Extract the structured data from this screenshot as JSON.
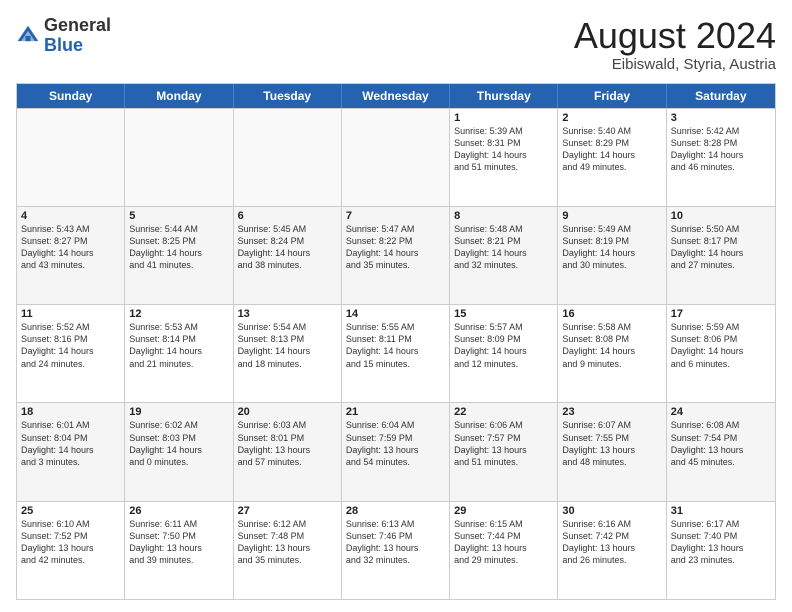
{
  "logo": {
    "general": "General",
    "blue": "Blue"
  },
  "title": {
    "month_year": "August 2024",
    "location": "Eibiswald, Styria, Austria"
  },
  "header_days": [
    "Sunday",
    "Monday",
    "Tuesday",
    "Wednesday",
    "Thursday",
    "Friday",
    "Saturday"
  ],
  "weeks": [
    [
      {
        "day": "",
        "info": "",
        "empty": true
      },
      {
        "day": "",
        "info": "",
        "empty": true
      },
      {
        "day": "",
        "info": "",
        "empty": true
      },
      {
        "day": "",
        "info": "",
        "empty": true
      },
      {
        "day": "1",
        "info": "Sunrise: 5:39 AM\nSunset: 8:31 PM\nDaylight: 14 hours\nand 51 minutes.",
        "empty": false
      },
      {
        "day": "2",
        "info": "Sunrise: 5:40 AM\nSunset: 8:29 PM\nDaylight: 14 hours\nand 49 minutes.",
        "empty": false
      },
      {
        "day": "3",
        "info": "Sunrise: 5:42 AM\nSunset: 8:28 PM\nDaylight: 14 hours\nand 46 minutes.",
        "empty": false
      }
    ],
    [
      {
        "day": "4",
        "info": "Sunrise: 5:43 AM\nSunset: 8:27 PM\nDaylight: 14 hours\nand 43 minutes.",
        "empty": false
      },
      {
        "day": "5",
        "info": "Sunrise: 5:44 AM\nSunset: 8:25 PM\nDaylight: 14 hours\nand 41 minutes.",
        "empty": false
      },
      {
        "day": "6",
        "info": "Sunrise: 5:45 AM\nSunset: 8:24 PM\nDaylight: 14 hours\nand 38 minutes.",
        "empty": false
      },
      {
        "day": "7",
        "info": "Sunrise: 5:47 AM\nSunset: 8:22 PM\nDaylight: 14 hours\nand 35 minutes.",
        "empty": false
      },
      {
        "day": "8",
        "info": "Sunrise: 5:48 AM\nSunset: 8:21 PM\nDaylight: 14 hours\nand 32 minutes.",
        "empty": false
      },
      {
        "day": "9",
        "info": "Sunrise: 5:49 AM\nSunset: 8:19 PM\nDaylight: 14 hours\nand 30 minutes.",
        "empty": false
      },
      {
        "day": "10",
        "info": "Sunrise: 5:50 AM\nSunset: 8:17 PM\nDaylight: 14 hours\nand 27 minutes.",
        "empty": false
      }
    ],
    [
      {
        "day": "11",
        "info": "Sunrise: 5:52 AM\nSunset: 8:16 PM\nDaylight: 14 hours\nand 24 minutes.",
        "empty": false
      },
      {
        "day": "12",
        "info": "Sunrise: 5:53 AM\nSunset: 8:14 PM\nDaylight: 14 hours\nand 21 minutes.",
        "empty": false
      },
      {
        "day": "13",
        "info": "Sunrise: 5:54 AM\nSunset: 8:13 PM\nDaylight: 14 hours\nand 18 minutes.",
        "empty": false
      },
      {
        "day": "14",
        "info": "Sunrise: 5:55 AM\nSunset: 8:11 PM\nDaylight: 14 hours\nand 15 minutes.",
        "empty": false
      },
      {
        "day": "15",
        "info": "Sunrise: 5:57 AM\nSunset: 8:09 PM\nDaylight: 14 hours\nand 12 minutes.",
        "empty": false
      },
      {
        "day": "16",
        "info": "Sunrise: 5:58 AM\nSunset: 8:08 PM\nDaylight: 14 hours\nand 9 minutes.",
        "empty": false
      },
      {
        "day": "17",
        "info": "Sunrise: 5:59 AM\nSunset: 8:06 PM\nDaylight: 14 hours\nand 6 minutes.",
        "empty": false
      }
    ],
    [
      {
        "day": "18",
        "info": "Sunrise: 6:01 AM\nSunset: 8:04 PM\nDaylight: 14 hours\nand 3 minutes.",
        "empty": false
      },
      {
        "day": "19",
        "info": "Sunrise: 6:02 AM\nSunset: 8:03 PM\nDaylight: 14 hours\nand 0 minutes.",
        "empty": false
      },
      {
        "day": "20",
        "info": "Sunrise: 6:03 AM\nSunset: 8:01 PM\nDaylight: 13 hours\nand 57 minutes.",
        "empty": false
      },
      {
        "day": "21",
        "info": "Sunrise: 6:04 AM\nSunset: 7:59 PM\nDaylight: 13 hours\nand 54 minutes.",
        "empty": false
      },
      {
        "day": "22",
        "info": "Sunrise: 6:06 AM\nSunset: 7:57 PM\nDaylight: 13 hours\nand 51 minutes.",
        "empty": false
      },
      {
        "day": "23",
        "info": "Sunrise: 6:07 AM\nSunset: 7:55 PM\nDaylight: 13 hours\nand 48 minutes.",
        "empty": false
      },
      {
        "day": "24",
        "info": "Sunrise: 6:08 AM\nSunset: 7:54 PM\nDaylight: 13 hours\nand 45 minutes.",
        "empty": false
      }
    ],
    [
      {
        "day": "25",
        "info": "Sunrise: 6:10 AM\nSunset: 7:52 PM\nDaylight: 13 hours\nand 42 minutes.",
        "empty": false
      },
      {
        "day": "26",
        "info": "Sunrise: 6:11 AM\nSunset: 7:50 PM\nDaylight: 13 hours\nand 39 minutes.",
        "empty": false
      },
      {
        "day": "27",
        "info": "Sunrise: 6:12 AM\nSunset: 7:48 PM\nDaylight: 13 hours\nand 35 minutes.",
        "empty": false
      },
      {
        "day": "28",
        "info": "Sunrise: 6:13 AM\nSunset: 7:46 PM\nDaylight: 13 hours\nand 32 minutes.",
        "empty": false
      },
      {
        "day": "29",
        "info": "Sunrise: 6:15 AM\nSunset: 7:44 PM\nDaylight: 13 hours\nand 29 minutes.",
        "empty": false
      },
      {
        "day": "30",
        "info": "Sunrise: 6:16 AM\nSunset: 7:42 PM\nDaylight: 13 hours\nand 26 minutes.",
        "empty": false
      },
      {
        "day": "31",
        "info": "Sunrise: 6:17 AM\nSunset: 7:40 PM\nDaylight: 13 hours\nand 23 minutes.",
        "empty": false
      }
    ]
  ]
}
